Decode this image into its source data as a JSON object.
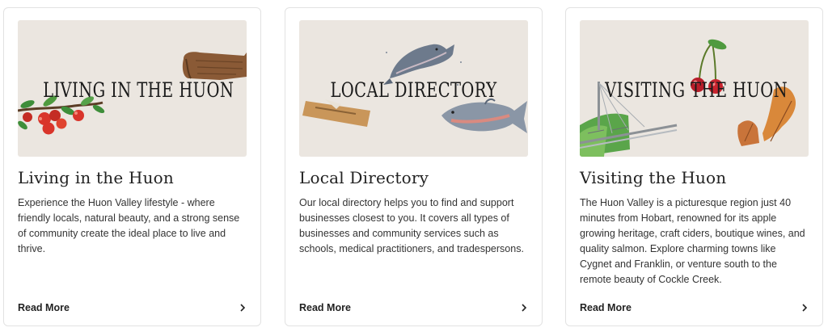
{
  "cards": [
    {
      "art_title": "Living in the Huon",
      "title": "Living in the Huon",
      "description": "Experience the Huon Valley lifestyle - where friendly locals, natural beauty, and a strong sense of community create the ideal place to live and thrive.",
      "link_label": "Read More",
      "link_icon": "chevron-right-icon"
    },
    {
      "art_title": "Local Directory",
      "title": "Local Directory",
      "description": "Our local directory helps you to find and support businesses closest to you. It covers all types of businesses and community services such as schools, medical practitioners, and tradespersons.",
      "link_label": "Read More",
      "link_icon": "chevron-right-icon"
    },
    {
      "art_title": "Visiting the Huon",
      "title": "Visiting the Huon",
      "description": "The Huon Valley is a picturesque region just 40 minutes from Hobart, renowned for its apple growing heritage, craft ciders, boutique wines, and quality salmon. Explore charming towns like Cygnet and Franklin, or venture south to the remote beauty of Cockle Creek.",
      "link_label": "Read More",
      "link_icon": "chevron-right-icon"
    }
  ],
  "colors": {
    "art_background": "#ebe6e0",
    "apple_red": "#d9352b",
    "leaf_green": "#3e8e3a",
    "salmon_grey": "#6d7a8c",
    "wood_brown": "#8a5a36"
  }
}
